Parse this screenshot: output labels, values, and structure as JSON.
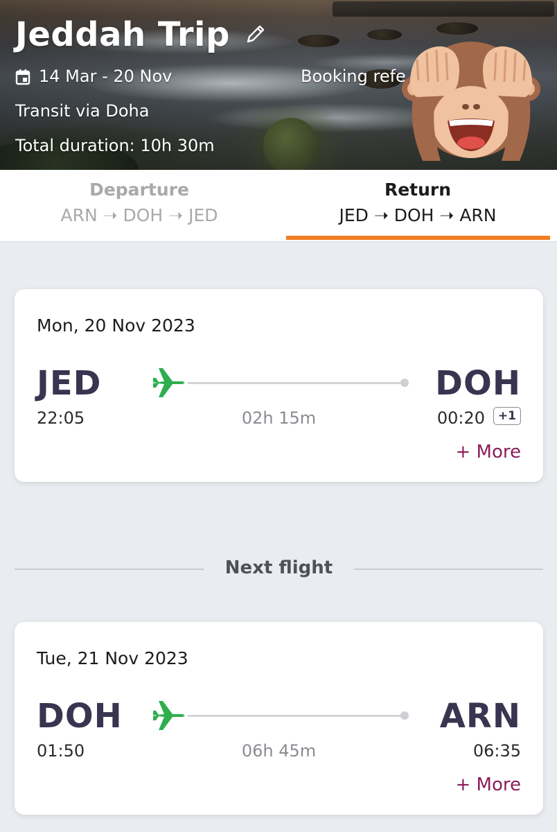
{
  "header": {
    "trip_title": "Jeddah Trip",
    "date_range": "14 Mar - 20 Nov",
    "booking_ref_label": "Booking refe",
    "transit": "Transit via Doha",
    "total_duration": "Total duration: 10h 30m"
  },
  "tabs": [
    {
      "title": "Departure",
      "route": "ARN ➝ DOH ➝ JED",
      "active": false
    },
    {
      "title": "Return",
      "route": "JED ➝ DOH ➝ ARN",
      "active": true
    }
  ],
  "accent_color": "#f07f24",
  "link_color": "#8b1d5a",
  "plane_color": "#2fae4e",
  "flights": [
    {
      "date": "Mon, 20 Nov 2023",
      "from_code": "JED",
      "to_code": "DOH",
      "dep_time": "22:05",
      "arr_time": "00:20",
      "day_offset": "+1",
      "duration": "02h 15m",
      "more_label": "+ More"
    },
    {
      "date": "Tue, 21 Nov 2023",
      "from_code": "DOH",
      "to_code": "ARN",
      "dep_time": "01:50",
      "arr_time": "06:35",
      "duration": "06h 45m",
      "more_label": "+ More"
    }
  ],
  "divider": {
    "label": "Next flight"
  },
  "icons": [
    "pencil-icon",
    "calendar-icon",
    "plane-icon",
    "see-no-evil-monkey-emoji"
  ]
}
